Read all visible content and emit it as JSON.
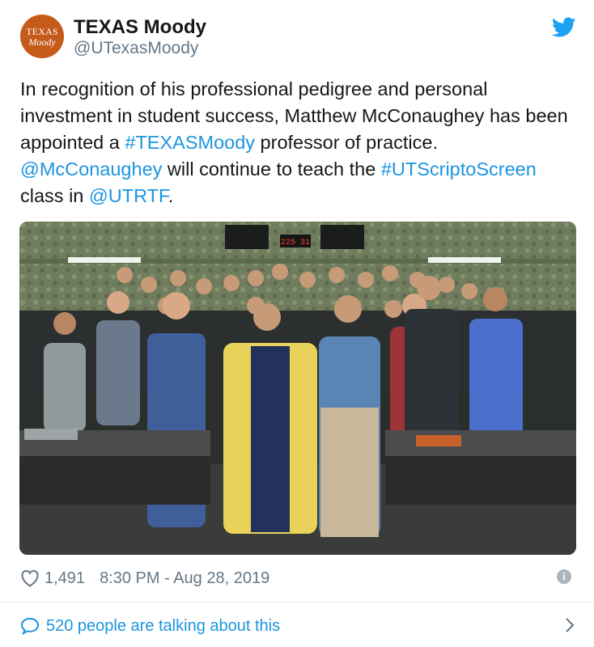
{
  "account": {
    "avatar_line1": "TEXAS",
    "avatar_line2": "Moody",
    "name": "TEXAS Moody",
    "handle": "@UTexasMoody"
  },
  "icons": {
    "brand": "twitter-bird-icon",
    "like": "heart-icon",
    "info": "info-icon",
    "reply": "speech-bubble-icon",
    "more": "chevron-right-icon"
  },
  "tweet": {
    "t1": "In recognition of his professional pedigree and personal investment in student success, Matthew McConaughey has been appointed a ",
    "h1": "#TEXASMoody",
    "t2": " professor of practice. ",
    "m1": "@McConaughey",
    "t3": " will continue to teach the ",
    "h2": "#UTScriptoScreen",
    "t4": " class in ",
    "m2": "@UTRTF",
    "t5": "."
  },
  "photo": {
    "description_label": "Group photo of a class with Matthew McConaughey",
    "clock_text": "225 31"
  },
  "meta": {
    "likes": "1,491",
    "timestamp": "8:30 PM - Aug 28, 2019",
    "info_glyph": "i"
  },
  "footer": {
    "talking": "520 people are talking about this"
  },
  "colors": {
    "link": "#1b95e0",
    "muted": "#657786",
    "avatar_bg": "#c55a1b"
  }
}
